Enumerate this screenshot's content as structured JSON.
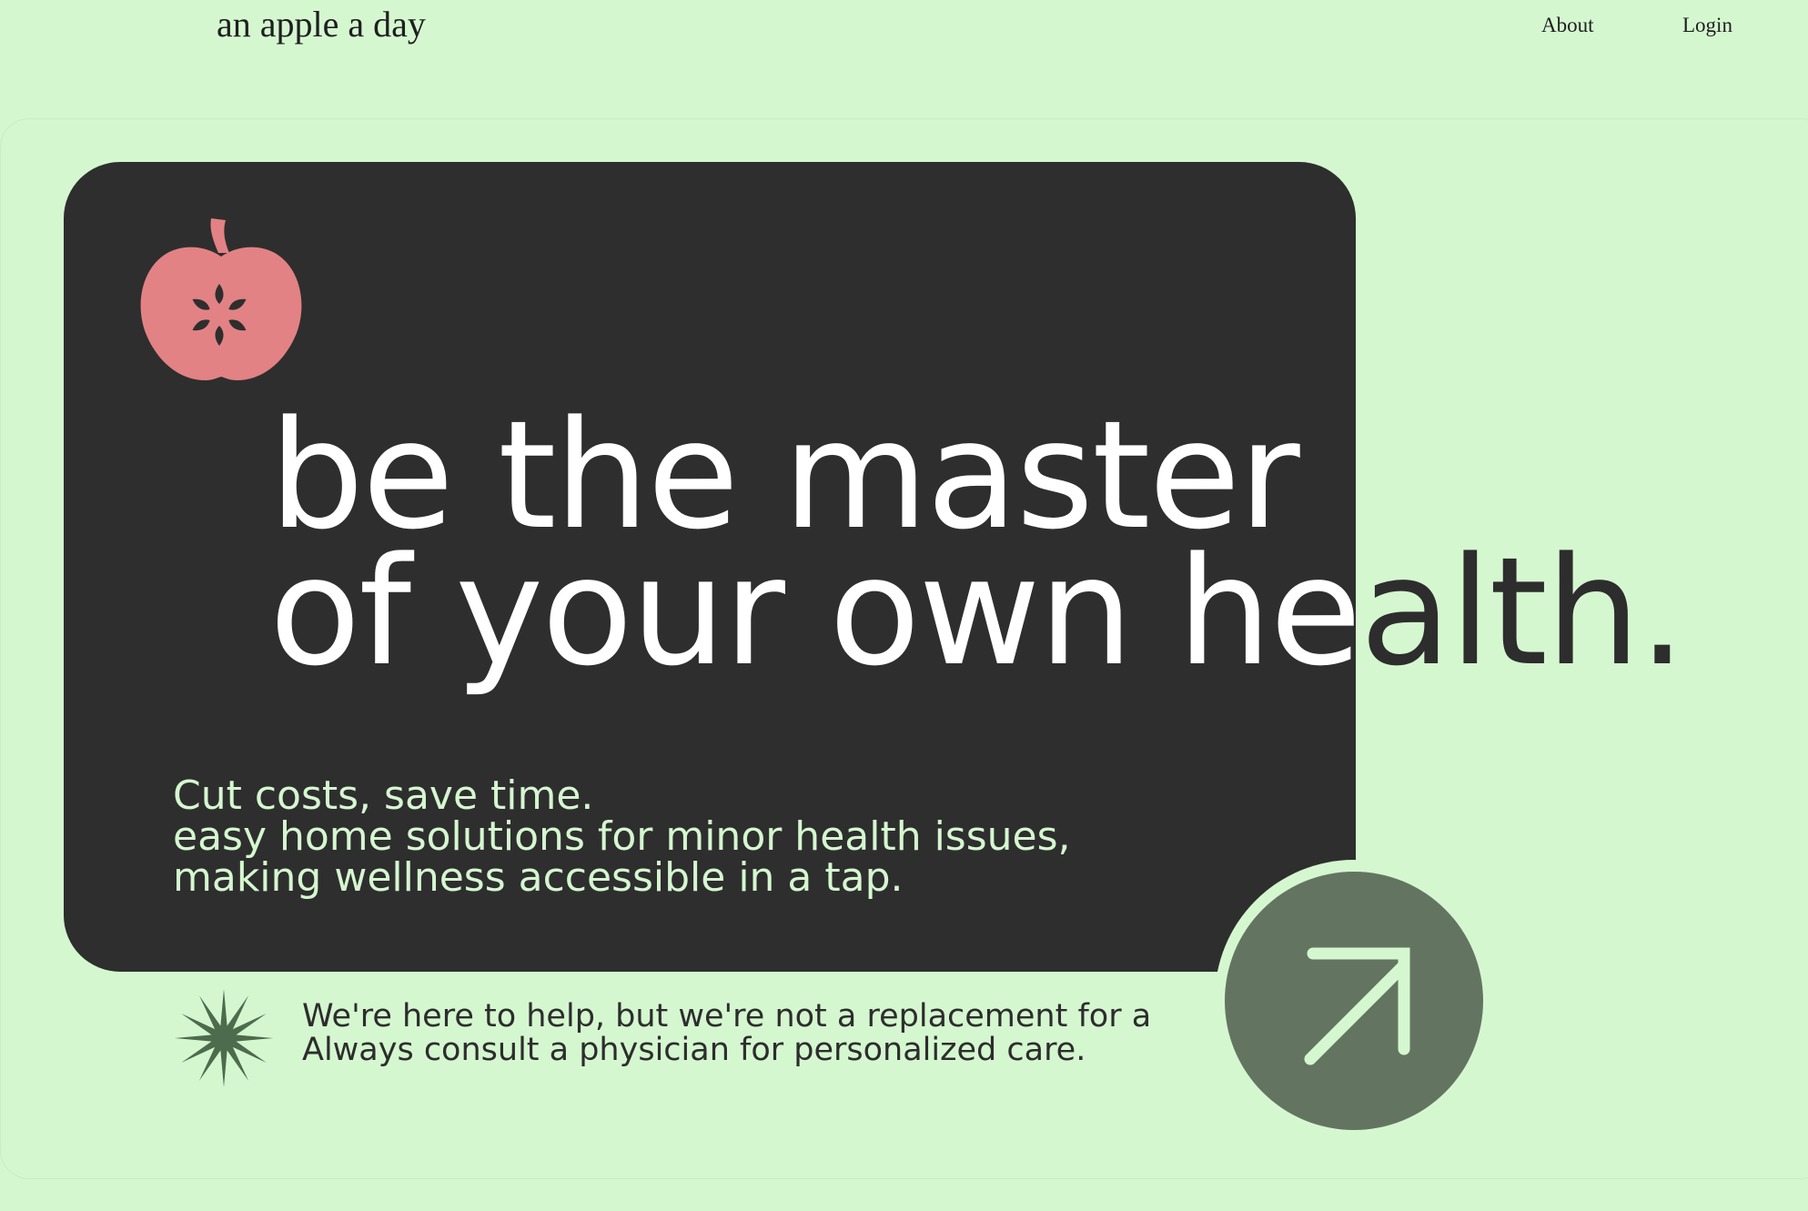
{
  "header": {
    "brand": "an apple a day",
    "nav": {
      "about": "About",
      "login": "Login"
    }
  },
  "hero": {
    "headline": {
      "line1": "be the master",
      "line2_light": "of your own he",
      "line2_dark": "alth."
    },
    "subcopy": {
      "line1": "Cut costs, save time.",
      "line2": "easy home solutions for minor health issues,",
      "line3": "making wellness accessible in a tap."
    },
    "disclaimer": {
      "line1": "We're here to help, but we're not a replacement for a",
      "line2": "Always consult a physician for personalized care."
    },
    "icons": {
      "logo": "apple-icon",
      "disclaimer": "starburst-icon",
      "cta": "arrow-up-right-icon"
    }
  },
  "colors": {
    "background": "#d5f7d0",
    "card": "#2e2e2e",
    "apple": "#e28284",
    "accent_green": "#637561",
    "star": "#4d6b4d",
    "text_dark": "#2d2d2d",
    "text_light": "#ffffff"
  }
}
